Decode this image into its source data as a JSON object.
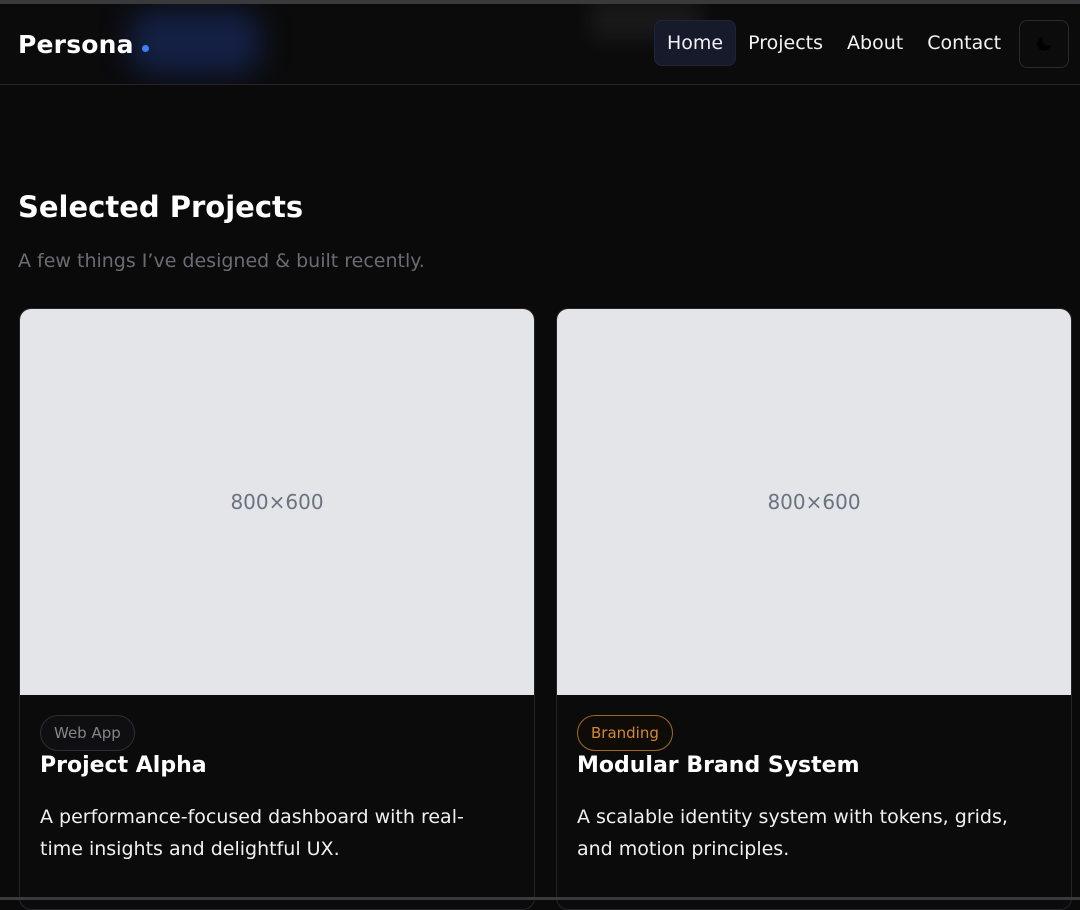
{
  "nav": {
    "brand": "Persona",
    "links": [
      "Home",
      "Projects",
      "About",
      "Contact"
    ],
    "active": "Home",
    "theme_icon": "moon-icon"
  },
  "section": {
    "title": "Selected Projects",
    "subtitle": "A few things I’ve designed & built recently."
  },
  "projects": [
    {
      "image_placeholder": "800×600",
      "tag": "Web App",
      "title": "Project Alpha",
      "description": "A performance-focused dashboard with real-time insights and delightful UX."
    },
    {
      "image_placeholder": "800×600",
      "tag": "Branding",
      "title": "Modular Brand System",
      "description": "A scalable identity system with tokens, grids, and motion principles."
    }
  ],
  "colors": {
    "background": "#0a0a0b",
    "accent_dot": "#3b82f6",
    "branding_tag": "#d38a2c",
    "placeholder_bg": "#e4e5e9"
  }
}
